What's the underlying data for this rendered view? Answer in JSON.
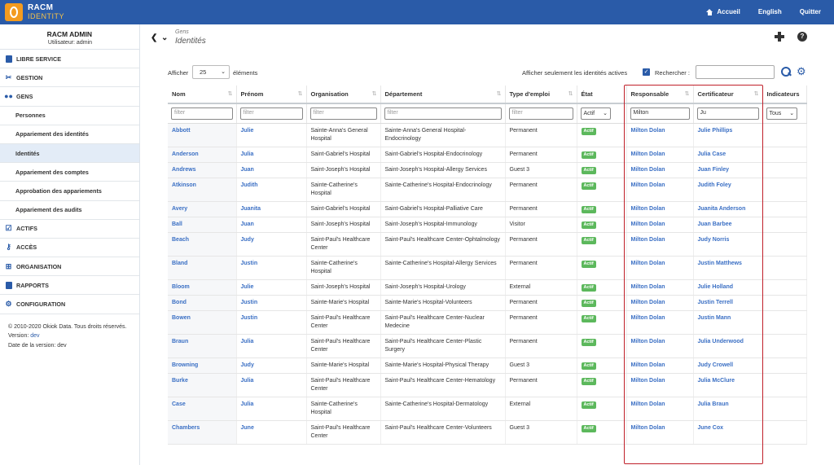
{
  "app": {
    "brand_line1": "RACM",
    "brand_line2": "IDENTITY"
  },
  "topnav": {
    "home": "Accueil",
    "lang": "English",
    "quit": "Quitter"
  },
  "user": {
    "name": "RACM ADMIN",
    "sub": "Utilisateur: admin"
  },
  "sidebar": {
    "items": [
      {
        "label": "LIBRE SERVICE",
        "icon": "clipboard-icon"
      },
      {
        "label": "GESTION",
        "icon": "tools-icon"
      },
      {
        "label": "GENS",
        "icon": "people-icon"
      },
      {
        "label": "Personnes"
      },
      {
        "label": "Appariement des identités"
      },
      {
        "label": "Identités",
        "active": true
      },
      {
        "label": "Appariement des comptes"
      },
      {
        "label": "Approbation des appariements"
      },
      {
        "label": "Appariement des audits"
      },
      {
        "label": "ACTIFS",
        "icon": "checkbox-icon"
      },
      {
        "label": "ACCÈS",
        "icon": "key-icon"
      },
      {
        "label": "ORGANISATION",
        "icon": "sitemap-icon"
      },
      {
        "label": "RAPPORTS",
        "icon": "report-icon"
      },
      {
        "label": "CONFIGURATION",
        "icon": "gear-icon"
      }
    ],
    "footer": {
      "copyright": "© 2010-2020 Okiok Data. Tous droits réservés.",
      "version_label": "Version:",
      "version": "dev",
      "date_label": "Date de la version: dev"
    }
  },
  "header": {
    "parent": "Gens",
    "title": "Identités"
  },
  "controls": {
    "show_label": "Afficher",
    "page_length": "25",
    "elements_label": "éléments",
    "active_only_label": "Afficher seulement les identités actives",
    "search_label": "Rechercher :",
    "search_value": ""
  },
  "table": {
    "columns": [
      "Nom",
      "Prénom",
      "Organisation",
      "Département",
      "Type d'emploi",
      "État",
      "Responsable",
      "Certificateur",
      "Indicateurs"
    ],
    "filters": {
      "placeholder": "filter",
      "etat": "Actif",
      "responsable": "Milton",
      "certificateur": "Ju",
      "indicateurs": "Tous"
    },
    "status_badge": "Actif",
    "rows": [
      {
        "nom": "Abbott",
        "prenom": "Julie",
        "org": "Sainte-Anna's General Hospital",
        "dept": "Sainte-Anna's General Hospital-Endocrinology",
        "type": "Permanent",
        "resp": "Milton Dolan",
        "cert": "Julie Phillips"
      },
      {
        "nom": "Anderson",
        "prenom": "Julia",
        "org": "Saint-Gabriel's Hospital",
        "dept": "Saint-Gabriel's Hospital-Endocrinology",
        "type": "Permanent",
        "resp": "Milton Dolan",
        "cert": "Julia Case"
      },
      {
        "nom": "Andrews",
        "prenom": "Juan",
        "org": "Saint-Joseph's Hospital",
        "dept": "Saint-Joseph's Hospital-Allergy Services",
        "type": "Guest 3",
        "resp": "Milton Dolan",
        "cert": "Juan Finley"
      },
      {
        "nom": "Atkinson",
        "prenom": "Judith",
        "org": "Sainte-Catherine's Hospital",
        "dept": "Sainte-Catherine's Hospital-Endocrinology",
        "type": "Permanent",
        "resp": "Milton Dolan",
        "cert": "Judith Foley"
      },
      {
        "nom": "Avery",
        "prenom": "Juanita",
        "org": "Saint-Gabriel's Hospital",
        "dept": "Saint-Gabriel's Hospital-Palliative Care",
        "type": "Permanent",
        "resp": "Milton Dolan",
        "cert": "Juanita Anderson"
      },
      {
        "nom": "Ball",
        "prenom": "Juan",
        "org": "Saint-Joseph's Hospital",
        "dept": "Saint-Joseph's Hospital-Immunology",
        "type": "Visitor",
        "resp": "Milton Dolan",
        "cert": "Juan Barbee"
      },
      {
        "nom": "Beach",
        "prenom": "Judy",
        "org": "Saint-Paul's Healthcare Center",
        "dept": "Saint-Paul's Healthcare Center-Ophtalmology",
        "type": "Permanent",
        "resp": "Milton Dolan",
        "cert": "Judy Norris"
      },
      {
        "nom": "Bland",
        "prenom": "Justin",
        "org": "Sainte-Catherine's Hospital",
        "dept": "Sainte-Catherine's Hospital-Allergy Services",
        "type": "Permanent",
        "resp": "Milton Dolan",
        "cert": "Justin Matthews"
      },
      {
        "nom": "Bloom",
        "prenom": "Julie",
        "org": "Saint-Joseph's Hospital",
        "dept": "Saint-Joseph's Hospital-Urology",
        "type": "External",
        "resp": "Milton Dolan",
        "cert": "Julie Holland"
      },
      {
        "nom": "Bond",
        "prenom": "Justin",
        "org": "Sainte-Marie's Hospital",
        "dept": "Sainte-Marie's Hospital-Volunteers",
        "type": "Permanent",
        "resp": "Milton Dolan",
        "cert": "Justin Terrell"
      },
      {
        "nom": "Bowen",
        "prenom": "Justin",
        "org": "Saint-Paul's Healthcare Center",
        "dept": "Saint-Paul's Healthcare Center-Nuclear Medecine",
        "type": "Permanent",
        "resp": "Milton Dolan",
        "cert": "Justin Mann"
      },
      {
        "nom": "Braun",
        "prenom": "Julia",
        "org": "Saint-Paul's Healthcare Center",
        "dept": "Saint-Paul's Healthcare Center-Plastic Surgery",
        "type": "Permanent",
        "resp": "Milton Dolan",
        "cert": "Julia Underwood"
      },
      {
        "nom": "Browning",
        "prenom": "Judy",
        "org": "Sainte-Marie's Hospital",
        "dept": "Sainte-Marie's Hospital-Physical Therapy",
        "type": "Guest 3",
        "resp": "Milton Dolan",
        "cert": "Judy Crowell"
      },
      {
        "nom": "Burke",
        "prenom": "Julia",
        "org": "Saint-Paul's Healthcare Center",
        "dept": "Saint-Paul's Healthcare Center-Hematology",
        "type": "Permanent",
        "resp": "Milton Dolan",
        "cert": "Julia McClure"
      },
      {
        "nom": "Case",
        "prenom": "Julia",
        "org": "Sainte-Catherine's Hospital",
        "dept": "Sainte-Catherine's Hospital-Dermatology",
        "type": "External",
        "resp": "Milton Dolan",
        "cert": "Julia Braun"
      },
      {
        "nom": "Chambers",
        "prenom": "June",
        "org": "Saint-Paul's Healthcare Center",
        "dept": "Saint-Paul's Healthcare Center-Volunteers",
        "type": "Guest 3",
        "resp": "Milton Dolan",
        "cert": "June Cox"
      }
    ]
  },
  "colors": {
    "brand": "#2a5ba8",
    "accent": "#f39b1f",
    "link": "#3a6fc4",
    "badge": "#5cb85c",
    "highlight_box": "#c0202a"
  }
}
